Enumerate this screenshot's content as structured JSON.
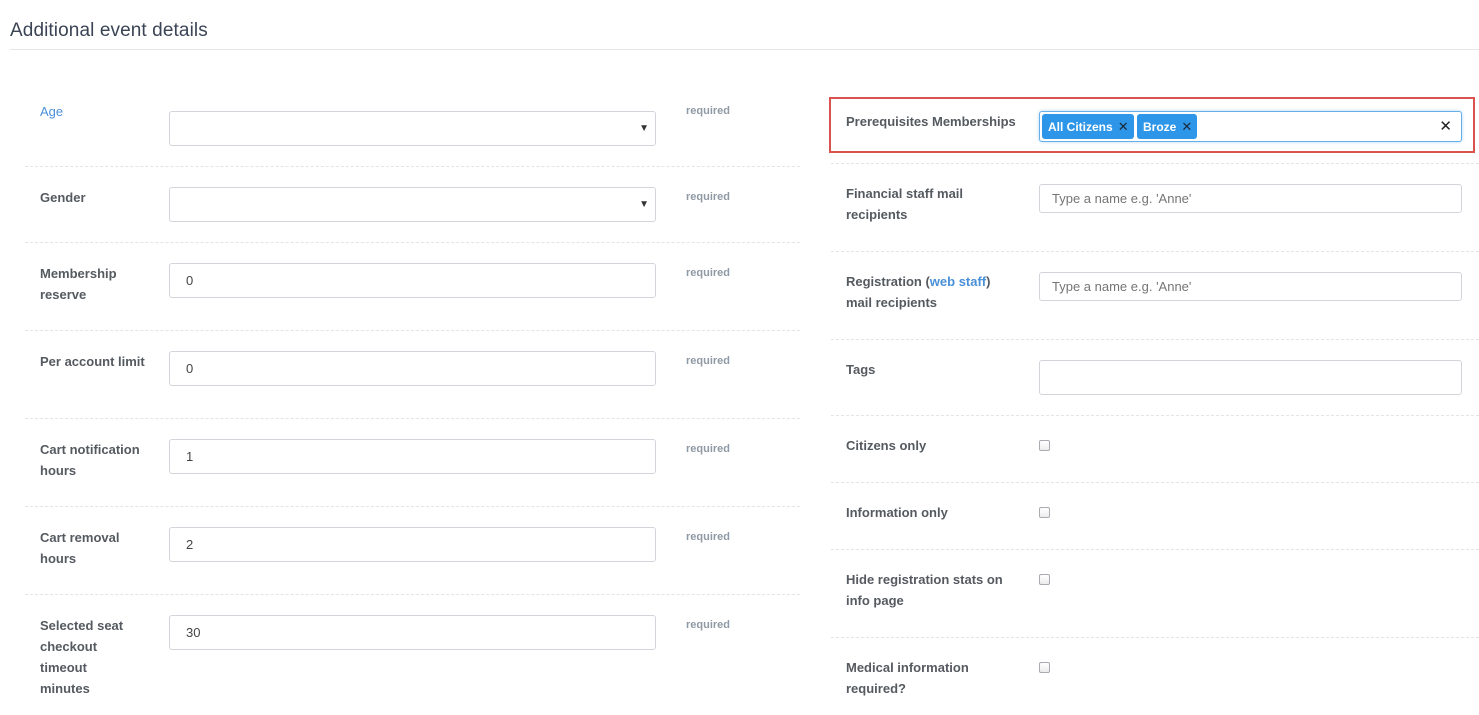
{
  "section": {
    "title": "Additional event details"
  },
  "left_fields": [
    {
      "label": "Age",
      "type": "select",
      "value": "",
      "hint": "required"
    },
    {
      "label": "Gender",
      "type": "select",
      "value": "",
      "hint": "required"
    },
    {
      "label": "Membership reserve",
      "type": "text",
      "value": "0",
      "hint": "required"
    },
    {
      "label": "Per account limit",
      "type": "text",
      "value": "0",
      "hint": "required"
    },
    {
      "label": "Cart notification hours",
      "type": "text",
      "value": "1",
      "hint": "required"
    },
    {
      "label": "Cart removal hours",
      "type": "text",
      "value": "2",
      "hint": "required"
    },
    {
      "label": "Selected seat checkout timeout minutes",
      "type": "text",
      "value": "30",
      "hint": "required"
    }
  ],
  "prerequisites": {
    "label": "Prerequisites Memberships",
    "tags": [
      {
        "label": "All Citizens"
      },
      {
        "label": "Broze"
      }
    ],
    "highlight_color": "#d9534f",
    "tag_color": "#2d96e8"
  },
  "financial_staff": {
    "label": "Financial staff mail recipients",
    "placeholder": "Type a name e.g. 'Anne'"
  },
  "registration": {
    "label_prefix": "Registration (",
    "label_link": "web staff",
    "label_suffix": ")",
    "label_line2": "mail recipients",
    "placeholder": "Type a name e.g. 'Anne'"
  },
  "tags_field": {
    "label": "Tags",
    "value": ""
  },
  "checkboxes": [
    {
      "label": "Citizens only",
      "checked": false
    },
    {
      "label": "Information only",
      "checked": false
    },
    {
      "label": "Hide registration stats on info page",
      "checked": false
    },
    {
      "label": "Medical information required?",
      "checked": false
    }
  ],
  "icons": {
    "caret": "caret-down-icon",
    "tag_remove": "close-icon",
    "clear_all": "close-icon"
  },
  "colors": {
    "link": "#4a90d9",
    "hint": "#8f9aa5",
    "label": "#555a60"
  }
}
